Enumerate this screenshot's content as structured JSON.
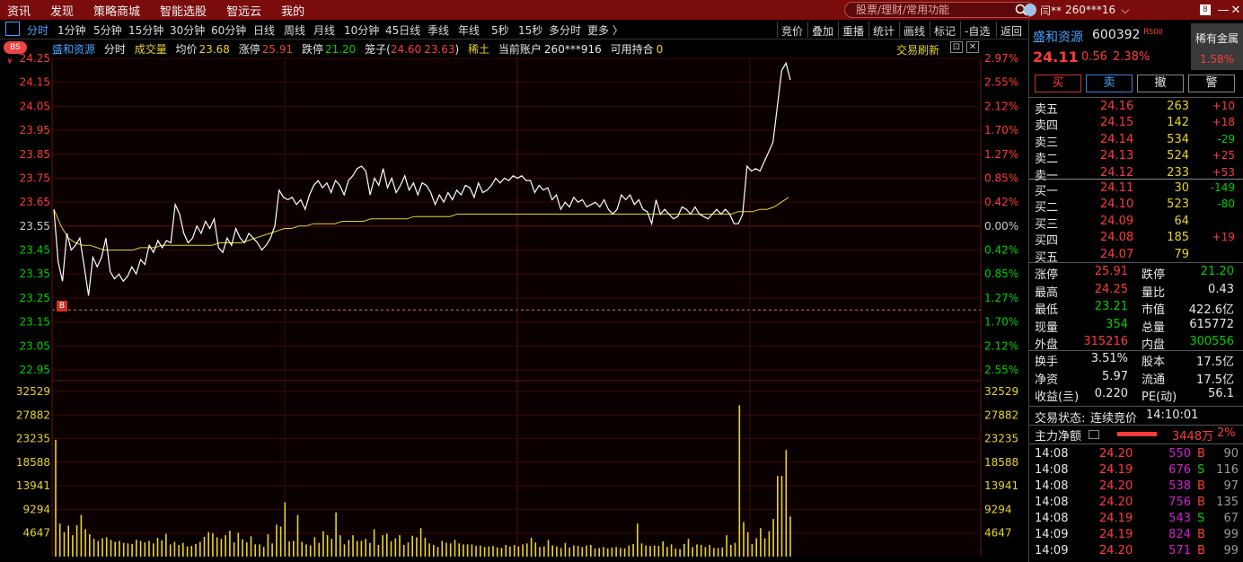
{
  "topbar": {
    "menu": [
      "资讯",
      "发现",
      "策略商城",
      "智能选股",
      "智远云",
      "我的"
    ],
    "search_placeholder": "股票/理财/常用功能",
    "user_name": "闫**",
    "user_account": "260***16"
  },
  "periods": [
    "分时",
    "1分钟",
    "5分钟",
    "15分钟",
    "30分钟",
    "60分钟",
    "日线",
    "周线",
    "月线",
    "10分钟",
    "45日线",
    "季线",
    "年线",
    "5秒",
    "15秒",
    "多分时",
    "更多 〉"
  ],
  "tools": [
    "竞价",
    "叠加",
    "重播",
    "统计",
    "画线",
    "标记",
    "-自选",
    "返回"
  ],
  "infobar": {
    "name": "盛和资源",
    "period": "分时",
    "vol_label": "成交量",
    "avg_label": "均价",
    "avg": "23.68",
    "limit_up_label": "涨停",
    "limit_up": "25.91",
    "limit_down_label": "跌停",
    "limit_down": "21.20",
    "cage_label": "笼子(",
    "cage_low": "24.60",
    "cage_high": "23.63",
    "cage_close": ")",
    "sector": "稀土",
    "account_label": "当前账户",
    "account": "260***916",
    "hold_label": "可用持合",
    "hold": "0",
    "trade_refresh": "交易刷新",
    "bs_badge": "BS",
    "b_marker": "B"
  },
  "chart_data": {
    "type": "line",
    "y_left_ticks": [
      "24.25",
      "24.15",
      "24.05",
      "23.95",
      "23.85",
      "23.75",
      "23.65",
      "23.55",
      "23.45",
      "23.35",
      "23.25",
      "23.15",
      "23.05",
      "22.95"
    ],
    "y_right_ticks": [
      "2.97%",
      "2.55%",
      "2.12%",
      "1.70%",
      "1.27%",
      "0.85%",
      "0.42%",
      "0.00%",
      "0.42%",
      "0.85%",
      "1.27%",
      "1.70%",
      "2.12%",
      "2.55%"
    ],
    "ylim": [
      22.95,
      24.25
    ],
    "vol_ticks": [
      "32529",
      "27882",
      "23235",
      "18588",
      "13941",
      "9294",
      "4647"
    ],
    "vol_max": 32529,
    "price": [
      23.62,
      23.4,
      23.32,
      23.52,
      23.45,
      23.47,
      23.5,
      23.38,
      23.26,
      23.42,
      23.38,
      23.42,
      23.5,
      23.36,
      23.33,
      23.35,
      23.32,
      23.34,
      23.38,
      23.35,
      23.41,
      23.39,
      23.47,
      23.44,
      23.49,
      23.46,
      23.49,
      23.48,
      23.64,
      23.6,
      23.52,
      23.48,
      23.5,
      23.55,
      23.52,
      23.57,
      23.54,
      23.58,
      23.46,
      23.44,
      23.5,
      23.47,
      23.54,
      23.5,
      23.48,
      23.52,
      23.5,
      23.48,
      23.45,
      23.47,
      23.5,
      23.55,
      23.7,
      23.67,
      23.66,
      23.67,
      23.64,
      23.66,
      23.62,
      23.68,
      23.72,
      23.74,
      23.71,
      23.73,
      23.69,
      23.74,
      23.72,
      23.68,
      23.74,
      23.76,
      23.79,
      23.8,
      23.78,
      23.68,
      23.75,
      23.72,
      23.79,
      23.71,
      23.75,
      23.69,
      23.72,
      23.76,
      23.7,
      23.73,
      23.68,
      23.73,
      23.72,
      23.69,
      23.64,
      23.68,
      23.65,
      23.69,
      23.66,
      23.7,
      23.68,
      23.72,
      23.71,
      23.67,
      23.73,
      23.69,
      23.7,
      23.72,
      23.75,
      23.73,
      23.75,
      23.74,
      23.76,
      23.75,
      23.76,
      23.74,
      23.74,
      23.69,
      23.72,
      23.7,
      23.71,
      23.66,
      23.68,
      23.62,
      23.65,
      23.63,
      23.67,
      23.65,
      23.66,
      23.63,
      23.64,
      23.65,
      23.63,
      23.66,
      23.62,
      23.6,
      23.62,
      23.68,
      23.66,
      23.68,
      23.64,
      23.66,
      23.62,
      23.61,
      23.56,
      23.66,
      23.6,
      23.62,
      23.6,
      23.58,
      23.59,
      23.63,
      23.62,
      23.6,
      23.63,
      23.6,
      23.59,
      23.58,
      23.6,
      23.62,
      23.6,
      23.62,
      23.6,
      23.56,
      23.56,
      23.6,
      23.8,
      23.78,
      23.79,
      23.78,
      23.82,
      23.86,
      23.9,
      24.05,
      24.2,
      24.23,
      24.16
    ],
    "avg_price": [
      23.62,
      23.55,
      23.5,
      23.48,
      23.47,
      23.47,
      23.46,
      23.45,
      23.45,
      23.45,
      23.45,
      23.45,
      23.46,
      23.46,
      23.46,
      23.47,
      23.47,
      23.47,
      23.47,
      23.47,
      23.47,
      23.47,
      23.47,
      23.48,
      23.48,
      23.48,
      23.48,
      23.49,
      23.5,
      23.51,
      23.52,
      23.53,
      23.54,
      23.54,
      23.55,
      23.55,
      23.56,
      23.56,
      23.56,
      23.56,
      23.57,
      23.57,
      23.57,
      23.57,
      23.58,
      23.58,
      23.58,
      23.58,
      23.58,
      23.58,
      23.59,
      23.59,
      23.59,
      23.59,
      23.59,
      23.59,
      23.6,
      23.6,
      23.6,
      23.6,
      23.6,
      23.6,
      23.6,
      23.6,
      23.6,
      23.6,
      23.6,
      23.6,
      23.6,
      23.6,
      23.6,
      23.6,
      23.6,
      23.6,
      23.6,
      23.6,
      23.6,
      23.6,
      23.6,
      23.6,
      23.6,
      23.6,
      23.6,
      23.6,
      23.6,
      23.6,
      23.6,
      23.6,
      23.6,
      23.6,
      23.6,
      23.6,
      23.6,
      23.6,
      23.6,
      23.61,
      23.61,
      23.61,
      23.62,
      23.62,
      23.63,
      23.65,
      23.67
    ],
    "volume": [
      23000,
      6500,
      4800,
      6100,
      4200,
      6200,
      8200,
      5400,
      4400,
      3500,
      3100,
      3600,
      3800,
      3300,
      2900,
      3100,
      2700,
      2600,
      2500,
      3300,
      3100,
      2800,
      3100,
      2600,
      3700,
      3200,
      4500,
      2400,
      2900,
      2300,
      2700,
      2000,
      2100,
      2500,
      2900,
      3900,
      4800,
      4600,
      3800,
      3500,
      4200,
      5100,
      2800,
      4700,
      3400,
      2800,
      4000,
      2400,
      2400,
      1900,
      4400,
      2600,
      6300,
      5900,
      10700,
      3000,
      3100,
      8200,
      2900,
      2400,
      2200,
      3800,
      2700,
      5000,
      4200,
      3500,
      8700,
      4200,
      2400,
      3300,
      4200,
      3100,
      3100,
      3500,
      2700,
      5400,
      2300,
      4200,
      4500,
      3000,
      3600,
      4200,
      2300,
      2800,
      4100,
      3800,
      5600,
      3700,
      2600,
      2300,
      1900,
      3100,
      2700,
      2600,
      3300,
      2600,
      2400,
      2400,
      2400,
      2100,
      2200,
      1900,
      2000,
      2100,
      1800,
      1700,
      2300,
      2000,
      2300,
      2000,
      2400,
      2600,
      3700,
      2800,
      1900,
      2000,
      3300,
      2200,
      2000,
      1700,
      2700,
      1800,
      2200,
      2100,
      1900,
      2200,
      2300,
      1600,
      1700,
      1900,
      1600,
      1800,
      1900,
      1700,
      1600,
      2200,
      2500,
      6500,
      2600,
      2200,
      2100,
      2200,
      2100,
      3000,
      1900,
      2400,
      1600,
      1500,
      2500,
      3500,
      1900,
      2400,
      2300,
      1900,
      2300,
      1700,
      1700,
      1800,
      4200,
      2300,
      2700,
      29800,
      6800,
      4800,
      2500,
      3600,
      5600,
      3600,
      5000,
      7400,
      15900,
      15900,
      21000,
      7900
    ]
  },
  "quote": {
    "name": "盛和资源",
    "code": "600392",
    "r_badge": "R",
    "r_num": "500",
    "price": "24.11",
    "change": "0.56",
    "change_pct": "2.38%",
    "sector": "稀有金属",
    "sector_pct": "1.58%",
    "buy": "买",
    "sell": "卖",
    "cancel": "撤",
    "alert": "警"
  },
  "asks": [
    {
      "label": "卖五",
      "price": "24.16",
      "vol": "263",
      "diff": "+10"
    },
    {
      "label": "卖四",
      "price": "24.15",
      "vol": "142",
      "diff": "+18"
    },
    {
      "label": "卖三",
      "price": "24.14",
      "vol": "534",
      "diff": "-29"
    },
    {
      "label": "卖二",
      "price": "24.13",
      "vol": "524",
      "diff": "+25"
    },
    {
      "label": "卖一",
      "price": "24.12",
      "vol": "233",
      "diff": "+53"
    }
  ],
  "bids": [
    {
      "label": "买一",
      "price": "24.11",
      "vol": "30",
      "diff": "-149"
    },
    {
      "label": "买二",
      "price": "24.10",
      "vol": "523",
      "diff": "-80"
    },
    {
      "label": "买三",
      "price": "24.09",
      "vol": "64",
      "diff": ""
    },
    {
      "label": "买四",
      "price": "24.08",
      "vol": "185",
      "diff": "+19"
    },
    {
      "label": "买五",
      "price": "24.07",
      "vol": "79",
      "diff": ""
    }
  ],
  "stats": [
    [
      {
        "k": "涨停",
        "v": "25.91"
      },
      {
        "k": "跌停",
        "v": "21.20"
      }
    ],
    [
      {
        "k": "最高",
        "v": "24.25"
      },
      {
        "k": "量比",
        "v": "0.43"
      }
    ],
    [
      {
        "k": "最低",
        "v": "23.21"
      },
      {
        "k": "市值",
        "v": "422.6亿"
      }
    ],
    [
      {
        "k": "现量",
        "v": "354"
      },
      {
        "k": "总量",
        "v": "615772"
      }
    ],
    [
      {
        "k": "外盘",
        "v": "315216"
      },
      {
        "k": "内盘",
        "v": "300556"
      }
    ]
  ],
  "stats2": [
    [
      {
        "k": "换手",
        "v": "3.51%"
      },
      {
        "k": "股本",
        "v": "17.5亿"
      }
    ],
    [
      {
        "k": "净资",
        "v": "5.97"
      },
      {
        "k": "流通",
        "v": "17.5亿"
      }
    ],
    [
      {
        "k": "收益(亖)",
        "v": "0.220"
      },
      {
        "k": "PE(动)",
        "v": "56.1"
      }
    ]
  ],
  "trade_status": {
    "label": "交易状态:",
    "value": "连续竞价",
    "time": "14:10:01"
  },
  "main_flow": {
    "label": "主力净额",
    "amount": "3448万",
    "pct": "2%"
  },
  "ticks": [
    {
      "t": "14:08",
      "p": "24.20",
      "v": "550",
      "s": "B",
      "n": "90"
    },
    {
      "t": "14:08",
      "p": "24.19",
      "v": "676",
      "s": "S",
      "n": "116"
    },
    {
      "t": "14:08",
      "p": "24.20",
      "v": "538",
      "s": "B",
      "n": "97"
    },
    {
      "t": "14:08",
      "p": "24.20",
      "v": "756",
      "s": "B",
      "n": "135"
    },
    {
      "t": "14:08",
      "p": "24.19",
      "v": "543",
      "s": "S",
      "n": "67"
    },
    {
      "t": "14:09",
      "p": "24.19",
      "v": "824",
      "s": "B",
      "n": "99"
    },
    {
      "t": "14:09",
      "p": "24.20",
      "v": "571",
      "s": "B",
      "n": "99"
    }
  ]
}
